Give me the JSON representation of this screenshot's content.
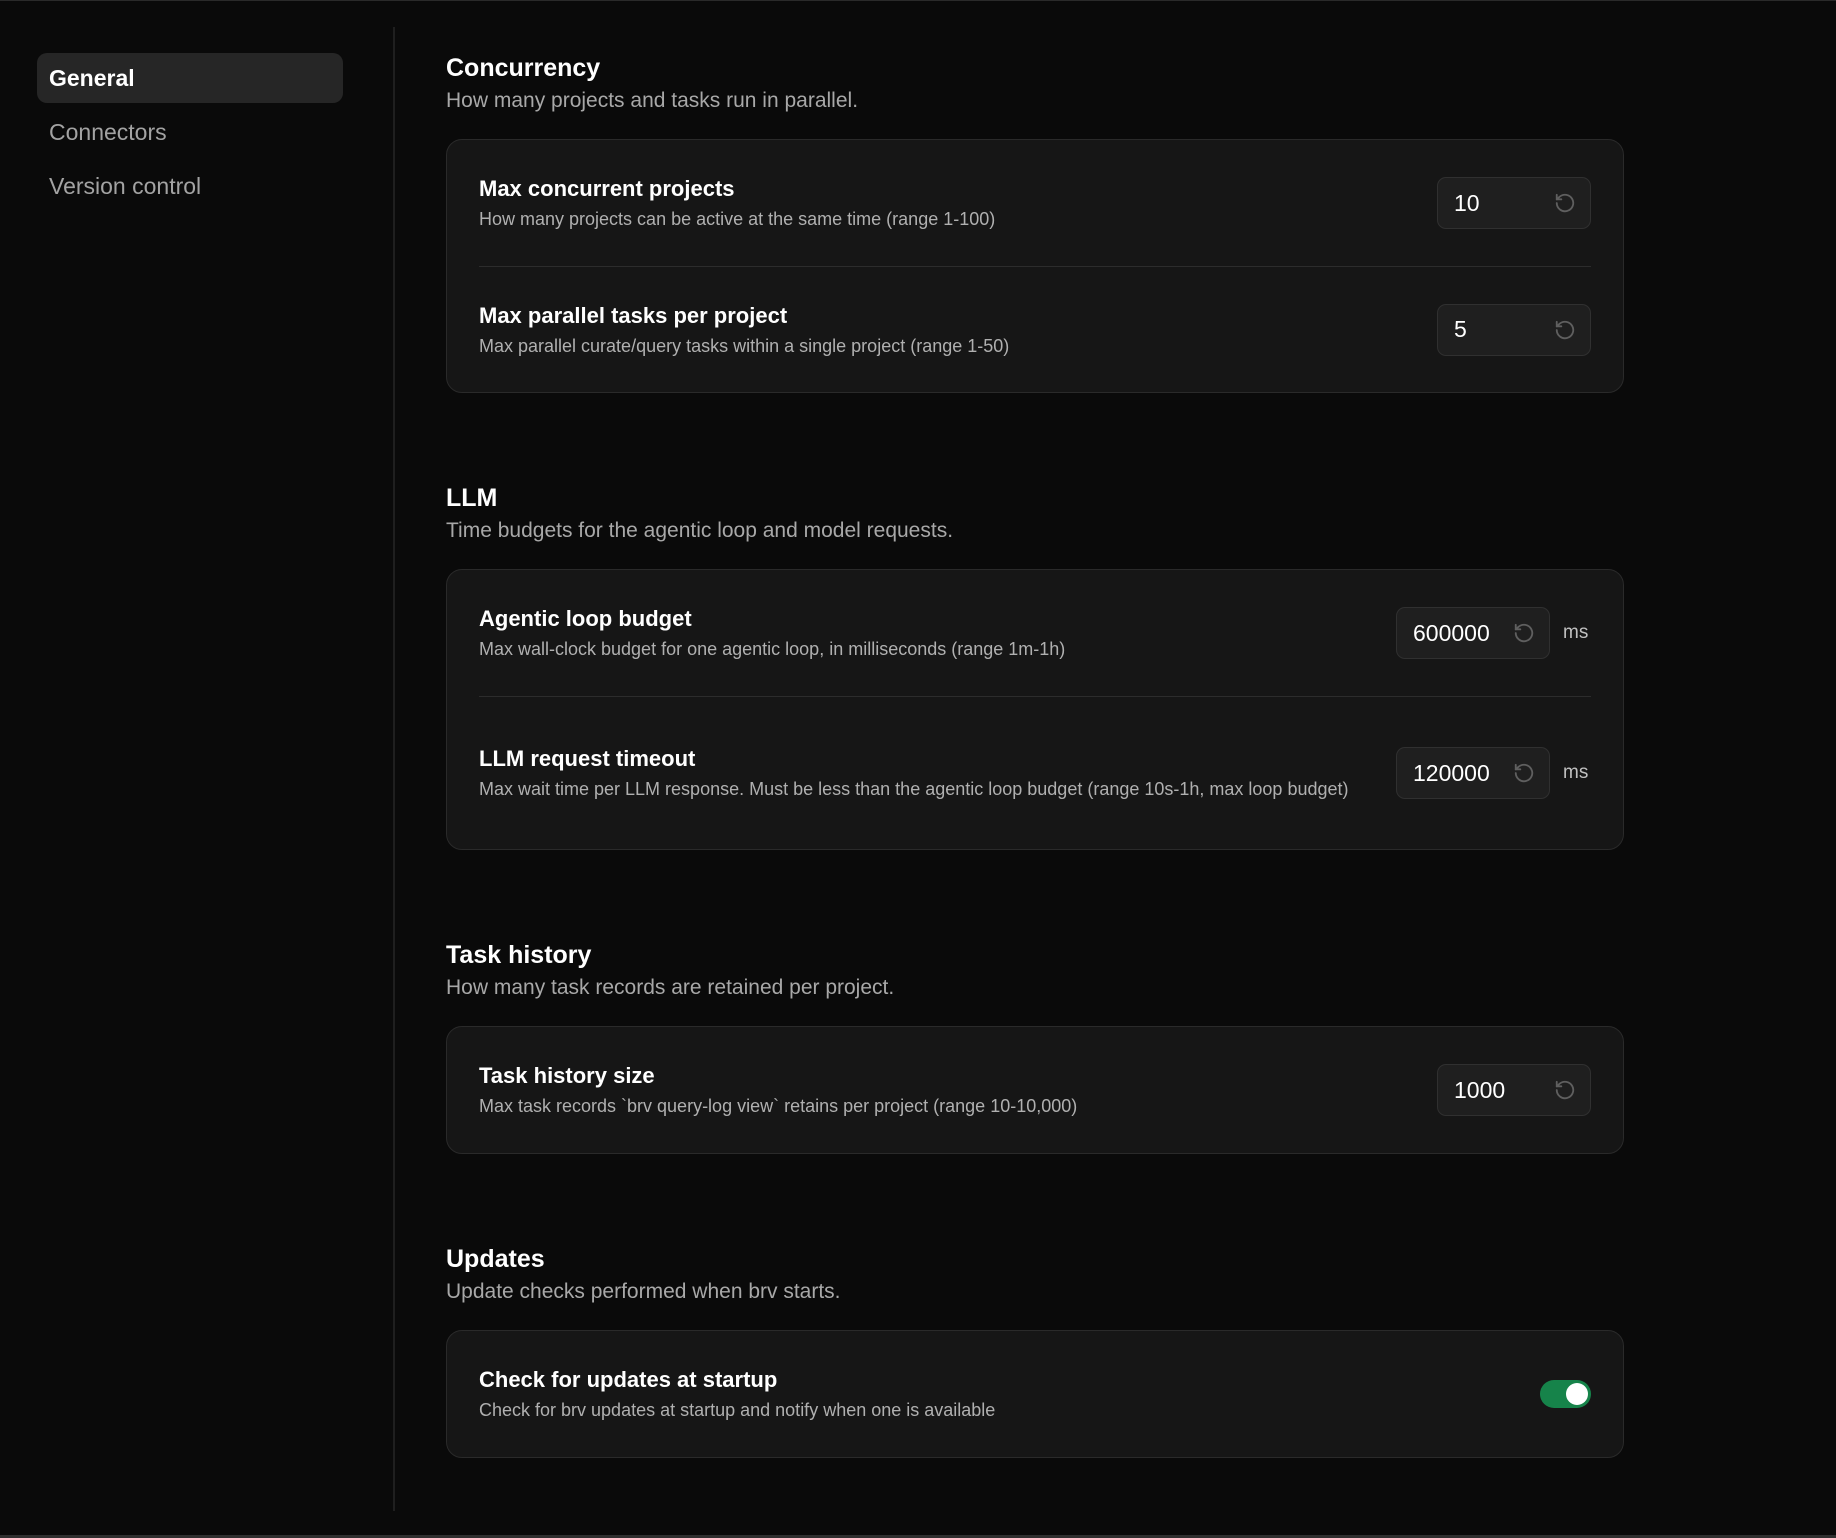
{
  "sidebar": {
    "items": [
      {
        "label": "General",
        "active": true
      },
      {
        "label": "Connectors",
        "active": false
      },
      {
        "label": "Version control",
        "active": false
      }
    ]
  },
  "sections": {
    "concurrency": {
      "title": "Concurrency",
      "description": "How many projects and tasks run in parallel.",
      "max_projects": {
        "title": "Max concurrent projects",
        "description": "How many projects can be active at the same time (range 1-100)",
        "value": "10"
      },
      "max_tasks": {
        "title": "Max parallel tasks per project",
        "description": "Max parallel curate/query tasks within a single project (range 1-50)",
        "value": "5"
      }
    },
    "llm": {
      "title": "LLM",
      "description": "Time budgets for the agentic loop and model requests.",
      "loop_budget": {
        "title": "Agentic loop budget",
        "description": "Max wall-clock budget for one agentic loop, in milliseconds (range 1m-1h)",
        "value": "600000",
        "unit": "ms"
      },
      "request_timeout": {
        "title": "LLM request timeout",
        "description": "Max wait time per LLM response. Must be less than the agentic loop budget (range 10s-1h, max loop budget)",
        "value": "120000",
        "unit": "ms"
      }
    },
    "task_history": {
      "title": "Task history",
      "description": "How many task records are retained per project.",
      "history_size": {
        "title": "Task history size",
        "description": "Max task records `brv query-log view` retains per project (range 10-10,000)",
        "value": "1000"
      }
    },
    "updates": {
      "title": "Updates",
      "description": "Update checks performed when brv starts.",
      "check_startup": {
        "title": "Check for updates at startup",
        "description": "Check for brv updates at startup and notify when one is available",
        "enabled": true
      }
    }
  },
  "icons": {
    "reset": "reset-icon"
  },
  "colors": {
    "background": "#0a0a0a",
    "card": "#161616",
    "toggle_on": "#16834a"
  }
}
